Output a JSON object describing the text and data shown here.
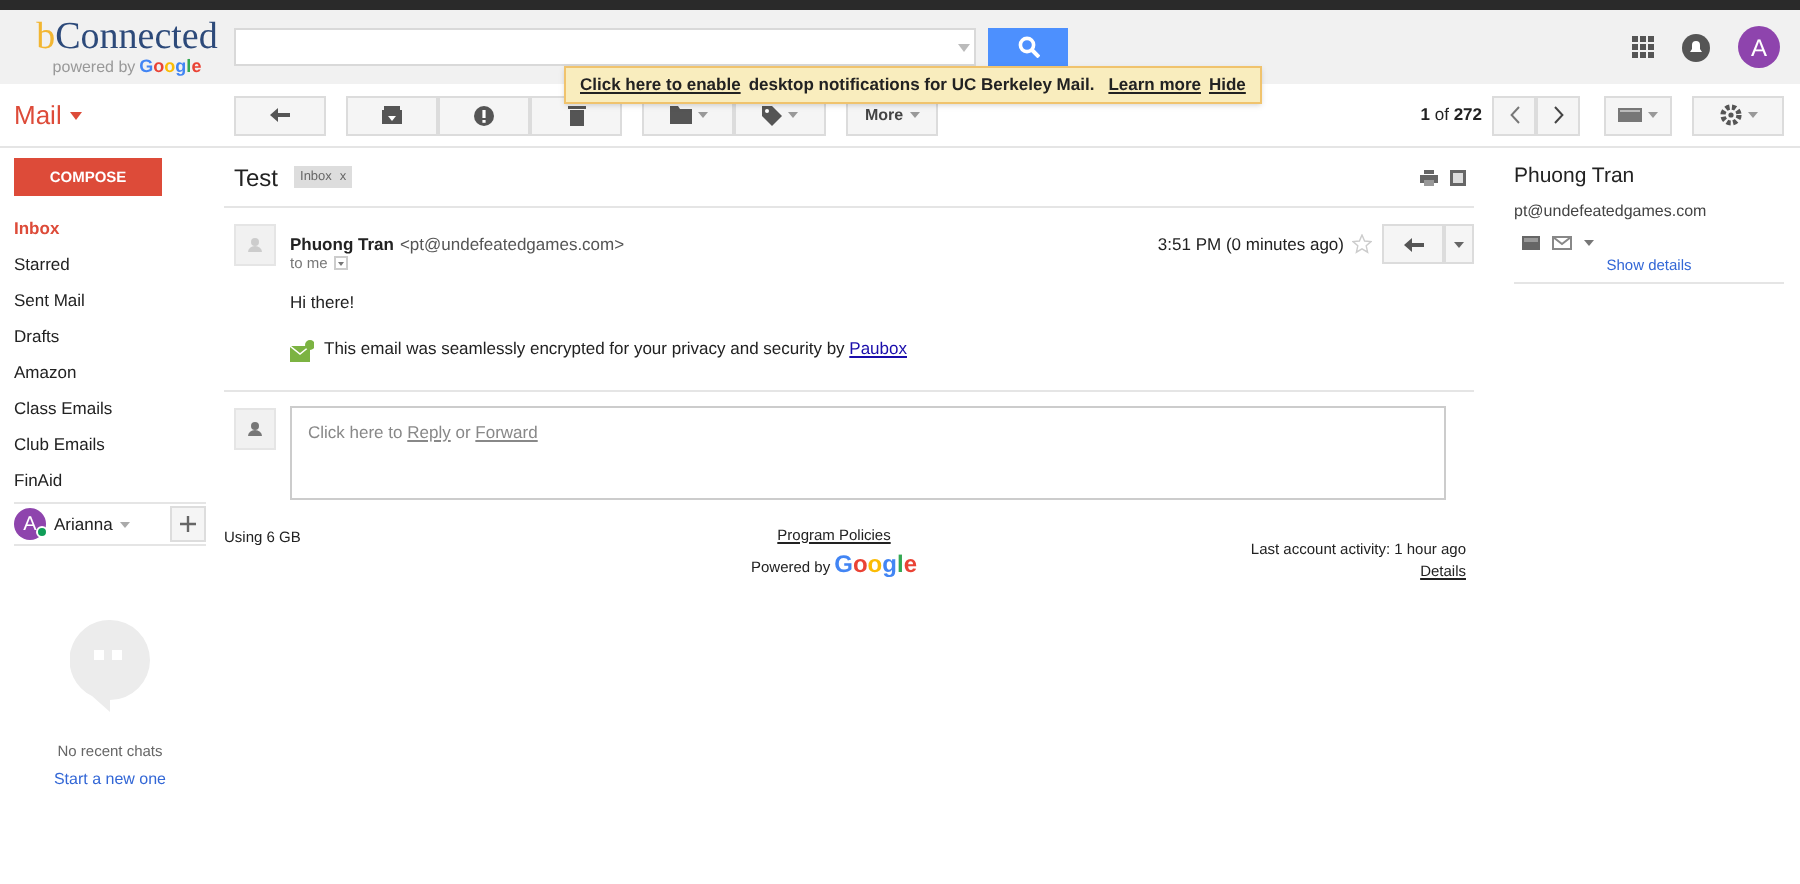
{
  "logo": {
    "initial": "b",
    "rest": "Connected",
    "tagline": "powered by",
    "brand": "Google"
  },
  "header": {
    "account_initial": "A"
  },
  "notification": {
    "link": "Click here to enable",
    "text": "desktop notifications for UC Berkeley Mail.",
    "actions": [
      "Learn more",
      "Hide"
    ]
  },
  "app_switcher": {
    "label": "Mail"
  },
  "toolbar": {
    "more_label": "More",
    "pager": {
      "current": "1",
      "of": "of",
      "total": "272"
    }
  },
  "compose": {
    "label": "COMPOSE"
  },
  "sidebar": {
    "items": [
      {
        "label": "Inbox",
        "selected": true
      },
      {
        "label": "Starred",
        "selected": false
      },
      {
        "label": "Sent Mail",
        "selected": false
      },
      {
        "label": "Drafts",
        "selected": false
      },
      {
        "label": "Amazon",
        "selected": false
      },
      {
        "label": "Class Emails",
        "selected": false
      },
      {
        "label": "Club Emails",
        "selected": false
      },
      {
        "label": "FinAid",
        "selected": false
      }
    ],
    "account": {
      "initial": "A",
      "name": "Arianna",
      "online": true
    },
    "chats": {
      "empty": "No recent chats",
      "link": "Start a new one"
    }
  },
  "thread": {
    "subject": "Test",
    "label": {
      "text": "Inbox",
      "remove": "x"
    },
    "message": {
      "sender": "Phuong Tran",
      "address": "<pt@undefeatedgames.com>",
      "recipient": "to me",
      "time": "3:51 PM (0 minutes ago)",
      "starred": false,
      "body": "Hi there!",
      "note": {
        "text": "This email was seamlessly encrypted for your privacy and security by",
        "link": "Paubox"
      }
    },
    "reply_box": {
      "parts": [
        {
          "kind": "text",
          "text": "Click here to"
        },
        {
          "kind": "link",
          "text": "Reply"
        },
        {
          "kind": "text",
          "text": "or"
        },
        {
          "kind": "link",
          "text": "Forward"
        }
      ]
    }
  },
  "footer": {
    "storage": "Using 6 GB",
    "policies": "Program Policies",
    "powered": "Powered by",
    "brand": "Google",
    "activity": "Last account activity: 1 hour ago",
    "details": "Details"
  },
  "contact": {
    "name": "Phuong Tran",
    "email": "pt@undefeatedgames.com",
    "details": "Show details"
  }
}
